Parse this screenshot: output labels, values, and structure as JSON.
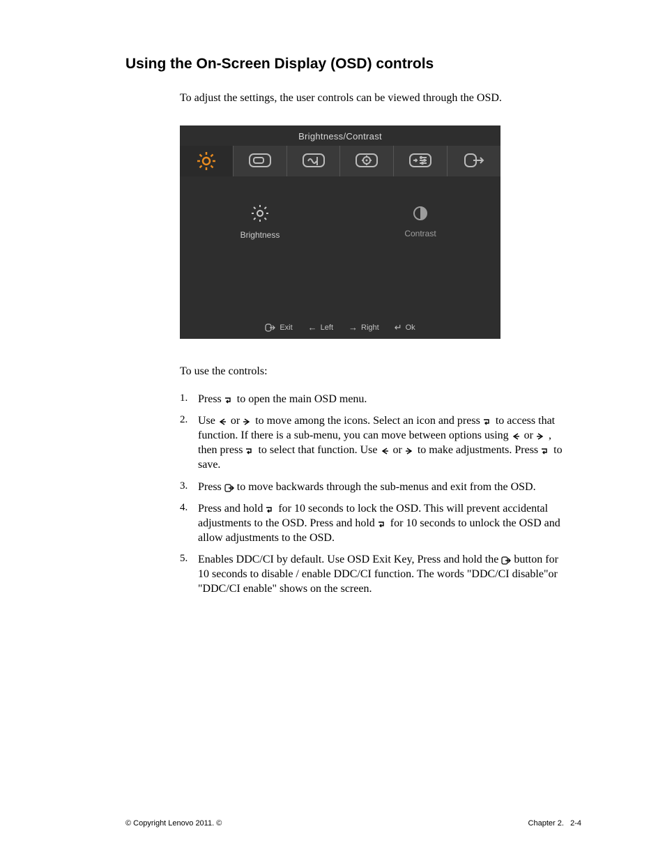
{
  "heading": "Using the On-Screen Display (OSD) controls",
  "intro": "To adjust the settings, the user controls can be viewed through the OSD.",
  "osd": {
    "title": "Brightness/Contrast",
    "tabs": [
      {
        "name": "brightness-contrast-tab",
        "active": true
      },
      {
        "name": "image-position-tab",
        "active": false
      },
      {
        "name": "image-setup-tab",
        "active": false
      },
      {
        "name": "image-properties-tab",
        "active": false
      },
      {
        "name": "options-tab",
        "active": false
      },
      {
        "name": "exit-tab",
        "active": false
      }
    ],
    "submenu": {
      "left_label": "Brightness",
      "right_label": "Contrast"
    },
    "footer": {
      "exit": "Exit",
      "left": "Left",
      "right": "Right",
      "ok": "Ok"
    }
  },
  "lead": "To use the controls:",
  "steps": [
    {
      "num": "1.",
      "parts": [
        "Press ",
        {
          "icon": "enter"
        },
        " to open the main OSD menu."
      ]
    },
    {
      "num": "2.",
      "parts": [
        "Use ",
        {
          "icon": "left"
        },
        " or ",
        {
          "icon": "right"
        },
        " to move among the icons. Select an icon and press  ",
        {
          "icon": "enter"
        },
        " to access that function. If there is a sub-menu, you can move between options using ",
        {
          "icon": "left"
        },
        " or ",
        {
          "icon": "right"
        },
        " , then press  ",
        {
          "icon": "enter"
        },
        " to select that function. Use ",
        {
          "icon": "left"
        },
        " or ",
        {
          "icon": "right"
        },
        " to make adjustments. Press ",
        {
          "icon": "enter"
        },
        "  to save."
      ]
    },
    {
      "num": "3.",
      "parts": [
        "Press   ",
        {
          "icon": "exit"
        },
        "  to move backwards through the sub-menus and exit from the OSD."
      ]
    },
    {
      "num": "4.",
      "parts": [
        "Press and hold  ",
        {
          "icon": "enter"
        },
        "  for 10 seconds to lock the OSD. This will prevent accidental adjustments to the OSD. Press and hold ",
        {
          "icon": "enter"
        },
        "  for 10  seconds to unlock the OSD and allow adjustments to the OSD."
      ]
    },
    {
      "num": "5.",
      "parts": [
        "Enables DDC/CI by default. Use OSD Exit Key, Press and hold the ",
        {
          "icon": "exit"
        },
        " button for 10 seconds to disable / enable DDC/CI function. The words \"DDC/CI disable\"or \"DDC/CI enable\" shows on the screen."
      ]
    }
  ],
  "footer": {
    "copyright": "© Copyright Lenovo 2011. ©",
    "chapter": "Chapter 2.",
    "page": "2-4"
  }
}
